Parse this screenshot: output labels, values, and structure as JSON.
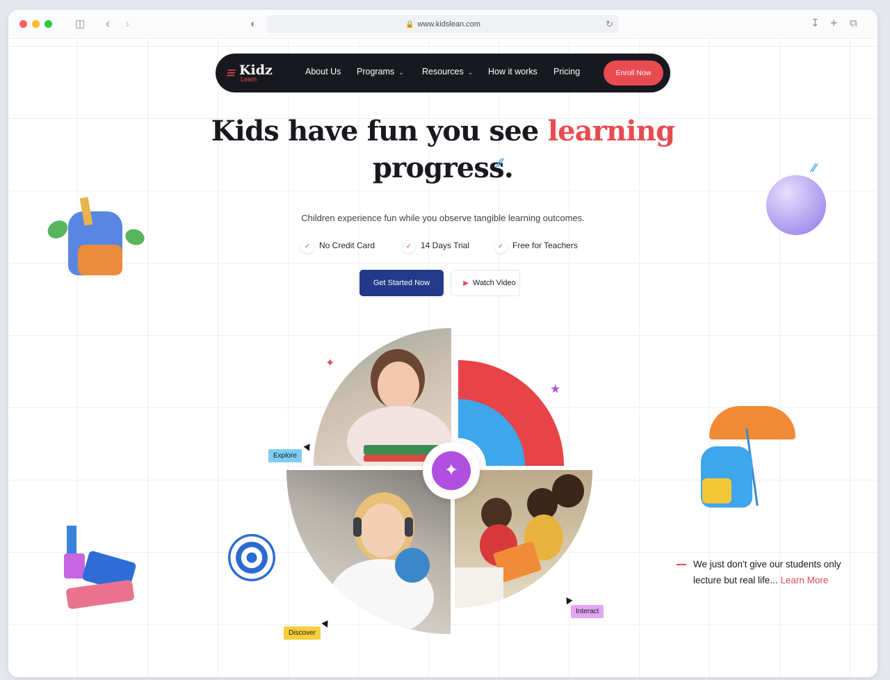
{
  "browser": {
    "url": "www.kidslean.com"
  },
  "nav": {
    "logo_main": "Kidz",
    "logo_sub": "Learn",
    "items": [
      {
        "label": "About Us"
      },
      {
        "label": "Programs"
      },
      {
        "label": "Resources"
      },
      {
        "label": "How it works"
      },
      {
        "label": "Pricing"
      }
    ],
    "cta": "Enroll Now"
  },
  "hero": {
    "headline_part1": "Kids have fun you see ",
    "headline_accent": "learning",
    "headline_part2": "progress.",
    "subtitle": "Children experience fun while you observe tangible learning outcomes.",
    "features": [
      "No Credit Card",
      "14 Days Trial",
      "Free for Teachers"
    ],
    "primary_button": "Get Started Now",
    "secondary_button": "Watch Video"
  },
  "tags": {
    "explore": "Explore",
    "discover": "Discover",
    "interact": "Interact"
  },
  "quote": {
    "text": "We just don't give our students only lecture but real life...",
    "link": "Learn More"
  },
  "colors": {
    "accent": "#e84b50",
    "primary": "#233a8a",
    "nav_bg": "#17191f",
    "sky": "#3aa7e6",
    "purple": "#b14fe0"
  }
}
